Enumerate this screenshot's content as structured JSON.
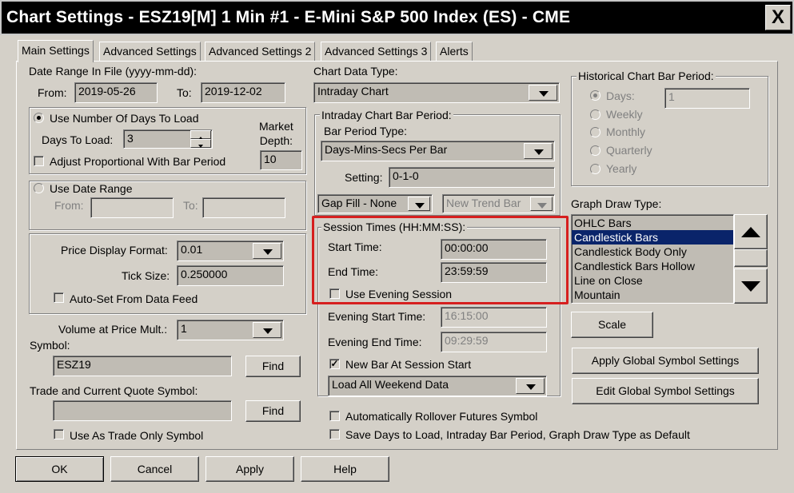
{
  "window": {
    "title": "Chart Settings - ESZ19[M]  1 Min   #1 - E-Mini S&P 500 Index (ES) - CME",
    "close_label": "X"
  },
  "tabs": [
    "Main Settings",
    "Advanced Settings",
    "Advanced Settings 2",
    "Advanced Settings 3",
    "Alerts"
  ],
  "date_range": {
    "label": "Date Range In File (yyyy-mm-dd):",
    "from_label": "From:",
    "from_value": "2019-05-26",
    "to_label": "To:",
    "to_value": "2019-12-02"
  },
  "days_group": {
    "use_days_label": "Use Number Of Days To Load",
    "days_label": "Days To Load:",
    "days_value": "3",
    "market_depth_label": "Market\nDepth:",
    "market_depth_value": "10",
    "adjust_label": "Adjust Proportional With Bar Period"
  },
  "date_range_group": {
    "use_date_range_label": "Use Date Range",
    "from_label": "From:",
    "to_label": "To:"
  },
  "price_group": {
    "format_label": "Price Display Format:",
    "format_value": "0.01",
    "tick_label": "Tick Size:",
    "tick_value": "0.250000",
    "auto_set_label": "Auto-Set From Data Feed"
  },
  "volume": {
    "label": "Volume at Price Mult.:",
    "value": "1"
  },
  "symbol": {
    "label": "Symbol:",
    "value": "ESZ19",
    "find_label": "Find"
  },
  "trade_symbol": {
    "label": "Trade and Current Quote Symbol:",
    "value": "",
    "find_label": "Find",
    "trade_only_label": "Use As Trade Only Symbol"
  },
  "chart_data_type": {
    "label": "Chart Data Type:",
    "value": "Intraday Chart"
  },
  "intraday": {
    "group_label": "Intraday Chart Bar Period:",
    "bar_period_type_label": "Bar Period Type:",
    "bar_period_type_value": "Days-Mins-Secs Per Bar",
    "setting_label": "Setting:",
    "setting_value": "0-1-0",
    "gap_fill_value": "Gap Fill - None",
    "new_trend_value": "New Trend Bar"
  },
  "session": {
    "group_label": "Session Times (HH:MM:SS):",
    "start_label": "Start Time:",
    "start_value": "00:00:00",
    "end_label": "End Time:",
    "end_value": "23:59:59",
    "evening_label": "Use Evening Session",
    "evening_start_label": "Evening Start Time:",
    "evening_start_value": "16:15:00",
    "evening_end_label": "Evening End Time:",
    "evening_end_value": "09:29:59",
    "new_bar_label": "New Bar At Session Start",
    "weekend_value": "Load All Weekend Data"
  },
  "rollover_label": "Automatically Rollover Futures Symbol",
  "save_default_label": "Save Days to Load, Intraday Bar Period, Graph Draw Type as Default",
  "historical": {
    "group_label": "Historical Chart Bar Period:",
    "options": [
      "Days:",
      "Weekly",
      "Monthly",
      "Quarterly",
      "Yearly"
    ],
    "days_value": "1"
  },
  "graph_draw": {
    "label": "Graph Draw Type:",
    "items": [
      "OHLC Bars",
      "Candlestick Bars",
      "Candlestick Body Only",
      "Candlestick Bars Hollow",
      "Line on Close",
      "Mountain"
    ],
    "selected_index": 1,
    "scale_label": "Scale"
  },
  "global_buttons": {
    "apply": "Apply Global Symbol Settings",
    "edit": "Edit Global Symbol Settings"
  },
  "footer": {
    "ok": "OK",
    "cancel": "Cancel",
    "apply": "Apply",
    "help": "Help"
  },
  "colors": {
    "highlight_border": "#d61f1f",
    "selection": "#0a246a",
    "dialog": "#d4d0c8"
  },
  "checkbox_check": "✓"
}
